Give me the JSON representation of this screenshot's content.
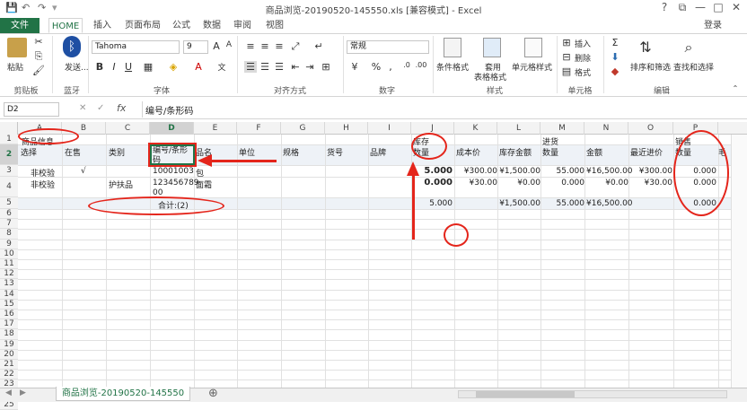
{
  "titlebar": {
    "title": "商品浏览-20190520-145550.xls  [兼容模式] - Excel",
    "help": "?",
    "login": "登录",
    "min": "—",
    "max": "□",
    "close": "✕",
    "restore": "⧉"
  },
  "tabs": [
    "文件",
    "HOME",
    "插入",
    "页面布局",
    "公式",
    "数据",
    "审阅",
    "视图"
  ],
  "ribbon": {
    "paste": "粘贴",
    "bluetooth_send": "发送...",
    "font_name": "Tahoma",
    "font_size": "9",
    "number_format": "常规",
    "conditional_format": "条件格式",
    "table_format_1": "套用",
    "table_format_2": "表格格式",
    "cell_style": "单元格样式",
    "insert": "插入",
    "delete": "删除",
    "format": "格式",
    "sort_filter": "排序和筛选",
    "find_select": "查找和选择",
    "groups": {
      "clipboard": "剪贴板",
      "bluetooth": "蓝牙",
      "font": "字体",
      "alignment": "对齐方式",
      "number": "数字",
      "styles": "样式",
      "cells": "单元格",
      "editing": "编辑"
    }
  },
  "formula_bar": {
    "name_box": "D2",
    "fx": "fx",
    "value": "编号/条形码"
  },
  "grid": {
    "columns": [
      "A",
      "B",
      "C",
      "D",
      "E",
      "F",
      "G",
      "H",
      "I",
      "J",
      "K",
      "L",
      "M",
      "N",
      "O",
      "P"
    ],
    "rows": [
      "1",
      "2",
      "3",
      "4",
      "5",
      "6",
      "7",
      "8",
      "9",
      "10",
      "11",
      "12",
      "13",
      "14",
      "15",
      "16",
      "17",
      "18",
      "19",
      "20",
      "21",
      "22",
      "23",
      "24",
      "25"
    ],
    "r1": {
      "product_info": "商品信息",
      "inventory": "库存",
      "purchase": "进货",
      "sales": "销售"
    },
    "headers": [
      "选择",
      "在售",
      "类别",
      "编号/条形码",
      "品名",
      "单位",
      "规格",
      "货号",
      "品牌",
      "数量",
      "成本价",
      "库存金额",
      "数量",
      "金额",
      "最近进价",
      "数量",
      "毛"
    ],
    "row3": {
      "a": "非校验",
      "b": "√",
      "d": "10001003",
      "e": "包",
      "j": "5.000",
      "k": "¥300.00",
      "l": "¥1,500.00",
      "m": "55.000",
      "n": "¥16,500.00",
      "o": "¥300.00",
      "p": "0.000"
    },
    "row4": {
      "a": "非校验",
      "c": "护扶品",
      "d": "123456789",
      "d2": "00",
      "e": "面霜",
      "j": "0.000",
      "k": "¥30.00",
      "l": "¥0.00",
      "m": "0.000",
      "n": "¥0.00",
      "o": "¥30.00",
      "p": "0.000"
    },
    "row5": {
      "d": "合计:(2)",
      "j": "5.000",
      "l": "¥1,500.00",
      "m": "55.000",
      "n": "¥16,500.00",
      "p": "0.000"
    }
  },
  "sheet": {
    "tab": "商品浏览-20190520-145550",
    "add": "⊕"
  },
  "colors": {
    "excel_green": "#217346",
    "annotation_red": "#e4251b"
  }
}
